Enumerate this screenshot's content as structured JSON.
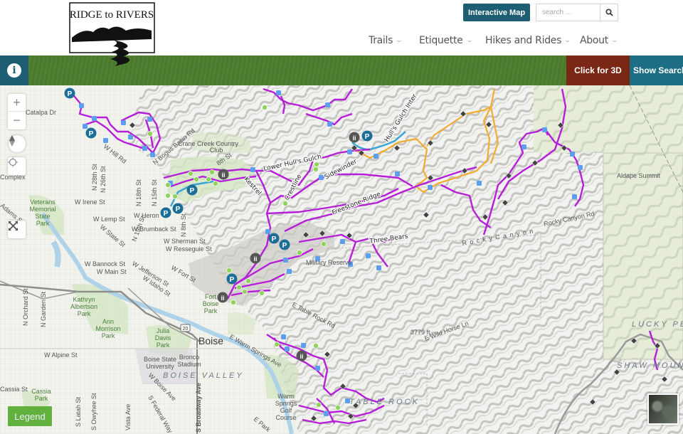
{
  "header": {
    "logo_text": "RIDGE to RIVERS",
    "interactive_map_label": "Interactive Map",
    "search_placeholder": "search ...",
    "nav": [
      {
        "label": "Trails"
      },
      {
        "label": "Etiquette"
      },
      {
        "label": "Hikes and Rides"
      },
      {
        "label": "About"
      }
    ]
  },
  "toolbar": {
    "info_icon": "i",
    "click_3d_label": "Click for 3D",
    "show_search_label": "Show Search",
    "colors": {
      "green_bar": "#4a7a2c",
      "teal": "#1d5e72",
      "brown": "#7a2716"
    }
  },
  "map": {
    "controls": {
      "zoom_in": "+",
      "zoom_out": "−",
      "legend_label": "Legend"
    },
    "trail_labels": {
      "lower_hulls_gulch": "Lower Hull's Gulch",
      "hulls_gulch_inter": "Hull's Gulch Inter",
      "kestrel": "Kestrel",
      "crestline": "Crestline",
      "sidewinder": "Sidewinder",
      "freestone_ridge": "Freestone Ridge",
      "three_bears": "Three Bears"
    },
    "place_labels": {
      "crane_creek": "Crane Creek Country",
      "crane_creek_2": "Club",
      "aldape_summit": "Aldape Summit",
      "rocky_canyon_rd": "Rocky Canyon Rd",
      "rocky_canyon": "R o c k y   C a n y o n",
      "lucky_peak": "LUCKY PE",
      "shaw_mountain": "SHAW MOUNT",
      "table_rock": "TABLE ROCK",
      "e_table_rock_rd": "E Table Rock Rd",
      "wild_horse": "E Wild Horse Ln",
      "elev_3779": "3779 ft",
      "boise": "Boise",
      "boise_valley": "BOISE VALLEY",
      "us20": "20",
      "catalpa": "Catalpa Dr",
      "complex": "Complex",
      "w_hill_rd": "W Hill Rd",
      "n_bogus": "N Bogus Basin Rd",
      "n28": "N 28th St",
      "n26": "N 26th St",
      "n18": "N 18th St",
      "n15": "N 15th St",
      "n8": "N 8th St",
      "n19": "N 19th St",
      "w_irene": "W Irene St",
      "w_lemp": "W Lemp St",
      "w_heron": "W Heron",
      "w_brumback": "W Brumback St",
      "w_sherman": "W Sherman St",
      "w_resseguie": "W Resseguie St",
      "w_state": "W State St",
      "w_bannock": "W Bannock St",
      "w_main": "W Main St",
      "w_jefferson": "W Jefferson St",
      "w_idaho": "W Idaho St",
      "w_fort": "W Fort St",
      "veterans": [
        "Veterans",
        "Memorial",
        "State",
        "Park"
      ],
      "kathryn": [
        "Kathryn",
        "Albertson",
        "Park"
      ],
      "ann": [
        "Ann",
        "Morrison",
        "Park"
      ],
      "julia": [
        "Julia",
        "Davis",
        "Park"
      ],
      "fort_boise": [
        "Fort",
        "Boise",
        "Park"
      ],
      "bsu": [
        "Boise State",
        "University"
      ],
      "bronco": [
        "Bronco",
        "Stadium"
      ],
      "warm_springs_golf": [
        "Warm",
        "Springs",
        "Golf",
        "Course"
      ],
      "cassia_park": [
        "Cassia",
        "Park"
      ],
      "n_orchard": "N Orchard St",
      "n_garden": "N Garden St",
      "w_alpine": "W Alpine St",
      "cassia_st": "Cassia St",
      "s_latah": "S Latah St",
      "s_owyhee": "S Owyhee St",
      "vista": "Vista Ave",
      "s_federal": "S Federal Way",
      "s_broadway": "S Broadway Ave",
      "w_boise_ave": "W Boise Ave",
      "e_warm_springs": "E Warm Springs Ave",
      "e_park": "E Park",
      "military": "Military Reserve",
      "kestrel_rd": "8th St",
      "adams": "Adams St"
    },
    "colors": {
      "trail_multi": "#b61fd8",
      "trail_hike": "#f2ac2e",
      "trail_bike": "#3aa7d2",
      "trail_gray": "#9a9a9a",
      "marker_blue": "#5c9ef0",
      "marker_green": "#8fd35a",
      "parking": "#1d6e96",
      "legend_green": "#62b13f"
    }
  }
}
